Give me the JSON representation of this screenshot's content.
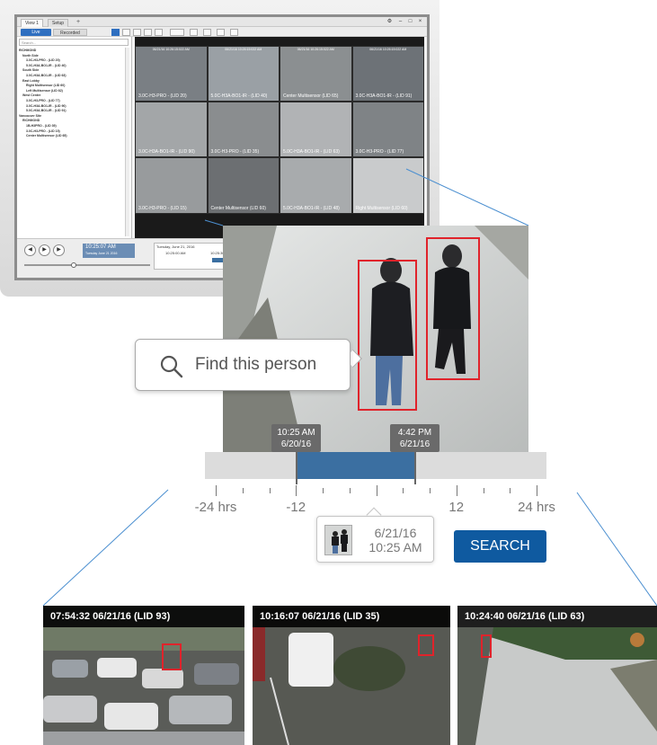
{
  "app": {
    "tabs": [
      "View 1",
      "Setup"
    ],
    "add_tab": "+",
    "mode_live": "Live",
    "mode_recorded": "Recorded",
    "search_placeholder": "Search...",
    "tree": [
      "RICHMOND",
      "North Side",
      "3.0C-H3-PRO - (LID 20)",
      "5.0C-H3A-BO1-IR - (LID 40)",
      "South Side",
      "3.0C-H3A-BO1-IR - (LID 63)",
      "East Lobby",
      "Right Multisensor (LID 60)",
      "Left Multisensor (LID 62)",
      "West Center",
      "3.0C-H3-PRO - (LID 77)",
      "3.0C-H3A-BO1-IR - (LID 90)",
      "5.0C-H3A-BO1-IR - (LID 91)",
      "Vancouver Site",
      "RICHMOND",
      "1B-H3PRO - (LID 39)",
      "3.0C-H3-PRO - (LID 15)",
      "Center Multisensor (LID 65)"
    ],
    "cells": [
      {
        "ts": "06/21/16  10:26:15:022 AM",
        "label": "3.0C-H3-PRO - (LID 20)"
      },
      {
        "ts": "06/21/16  10:26:15:022 AM",
        "label": "5.0C-H3A-BO1-IR - (LID 40)"
      },
      {
        "ts": "06/21/16  10:26:15:022 AM",
        "label": "Center Multisensor (LID 65)"
      },
      {
        "ts": "06/21/16  10:26:15:022 AM",
        "label": "3.0C-H3A-BO1-IR - (LID 91)"
      },
      {
        "ts": "",
        "label": "3.0C-H3A-BO1-IR - (LID 90)"
      },
      {
        "ts": "",
        "label": "3.0C-H3-PRO - (LID 35)"
      },
      {
        "ts": "",
        "label": "5.0C-H3A-BO1-IR - (LID 63)"
      },
      {
        "ts": "",
        "label": "3.0C-H3-PRO - (LID 77)"
      },
      {
        "ts": "",
        "label": "3.0C-H3-PRO - (LID 15)"
      },
      {
        "ts": "",
        "label": "Center Multisensor (LID 60)"
      },
      {
        "ts": "",
        "label": "5.0C-H3A-BO1-IR - (LID 48)"
      },
      {
        "ts": "",
        "label": "Right Multisensor (LID 60)"
      }
    ],
    "playback_time": "10:25:07 AM",
    "playback_date": "Tuesday June 21 2016",
    "timeline_date": "Tuesday, June 21, 2016",
    "timeline_marks": [
      "10:25:00 AM",
      "10:25:30 AM"
    ]
  },
  "find_person": {
    "label": "Find this person"
  },
  "range": {
    "start": {
      "time": "10:25 AM",
      "date": "6/20/16"
    },
    "end": {
      "time": "4:42 PM",
      "date": "6/21/16"
    },
    "ticks": [
      {
        "label": "-24",
        "unit": " hrs"
      },
      {
        "label": "-12",
        "unit": ""
      },
      {
        "label": "12",
        "unit": ""
      },
      {
        "label": "24",
        "unit": " hrs"
      }
    ]
  },
  "reference": {
    "date": "6/21/16",
    "time": "10:25 AM"
  },
  "search_button": "SEARCH",
  "results": [
    {
      "caption": "07:54:32  06/21/16  (LID 93)"
    },
    {
      "caption": "10:16:07  06/21/16  (LID 35)"
    },
    {
      "caption": "10:24:40  06/21/16  (LID 63)"
    }
  ],
  "colors": {
    "accent": "#0f5aa0",
    "range_fill": "#3b6fa1",
    "bbox": "#e0232b"
  }
}
